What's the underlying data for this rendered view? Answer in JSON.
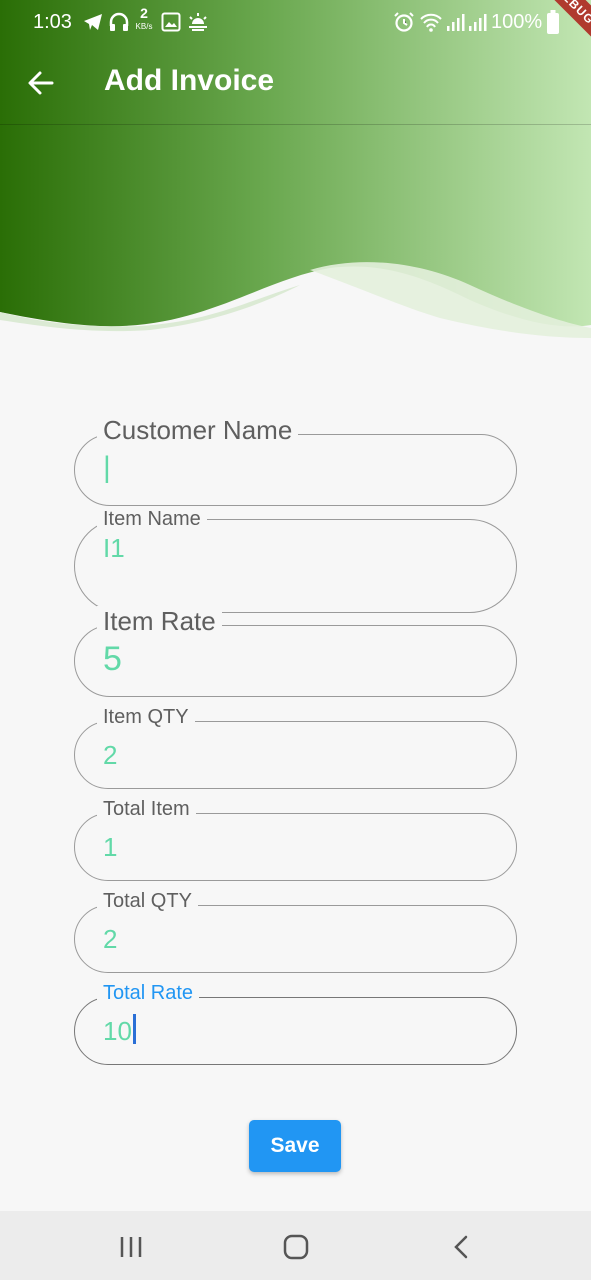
{
  "status_bar": {
    "time": "1:03",
    "network_speed": "2",
    "network_unit": "KB/s",
    "battery": "100%"
  },
  "debug_banner": "DEBUG",
  "app_bar": {
    "title": "Add Invoice",
    "gradient_start": "#2a6e06",
    "gradient_end": "#c2e6b3"
  },
  "form": {
    "customer_name": {
      "label": "Customer Name",
      "value": "|"
    },
    "item_name": {
      "label": "Item Name",
      "value": "I1"
    },
    "item_rate": {
      "label": "Item Rate",
      "value": "5"
    },
    "item_qty": {
      "label": "Item QTY",
      "value": "2"
    },
    "total_item": {
      "label": "Total Item",
      "value": "1"
    },
    "total_qty": {
      "label": "Total QTY",
      "value": "2"
    },
    "total_rate": {
      "label": "Total Rate",
      "value": "10"
    }
  },
  "save_label": "Save",
  "colors": {
    "accent": "#2196f3",
    "value_text": "#62d9a8",
    "background": "#f7f7f7"
  },
  "icons": [
    "back-arrow-icon",
    "telegram-icon",
    "headphones-icon",
    "gallery-icon",
    "weather-icon",
    "alarm-icon",
    "wifi-icon",
    "signal-icon",
    "battery-icon",
    "recent-apps-icon",
    "home-icon",
    "nav-back-icon"
  ]
}
